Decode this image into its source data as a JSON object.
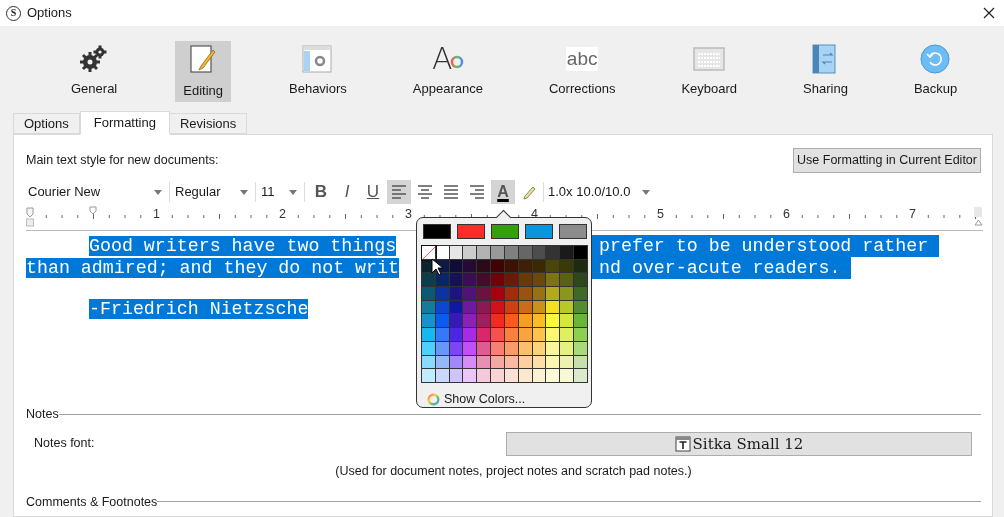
{
  "window": {
    "logo": "S",
    "title": "Options"
  },
  "categories": [
    {
      "label": "General",
      "selected": false
    },
    {
      "label": "Editing",
      "selected": true
    },
    {
      "label": "Behaviors",
      "selected": false
    },
    {
      "label": "Appearance",
      "icon_text": "A",
      "selected": false
    },
    {
      "label": "Corrections",
      "icon_text": "abc",
      "selected": false
    },
    {
      "label": "Keyboard",
      "selected": false
    },
    {
      "label": "Sharing",
      "selected": false
    },
    {
      "label": "Backup",
      "selected": false
    }
  ],
  "tabs": [
    {
      "label": "Options",
      "selected": false
    },
    {
      "label": "Formatting",
      "selected": true
    },
    {
      "label": "Revisions",
      "selected": false
    }
  ],
  "formatting": {
    "intro": "Main text style for new documents:",
    "apply_button": "Use Formatting in Current Editor",
    "font": "Courier New",
    "style": "Regular",
    "size": "11",
    "tools": [
      {
        "kind": "bold",
        "label": "B",
        "active": false
      },
      {
        "kind": "italic",
        "label": "I",
        "active": false
      },
      {
        "kind": "underline",
        "label": "U",
        "active": false
      },
      {
        "kind": "align-left",
        "active": true
      },
      {
        "kind": "align-center",
        "active": false
      },
      {
        "kind": "justify",
        "active": false
      },
      {
        "kind": "align-right",
        "active": false
      },
      {
        "kind": "text-color",
        "label": "A",
        "active": true
      },
      {
        "kind": "highlight",
        "active": false
      }
    ],
    "spacing": "1.0x 10.0/10.0",
    "ruler": [
      "1",
      "2",
      "3",
      "4",
      "5",
      "6",
      "7"
    ],
    "lines": [
      {
        "indent": true,
        "selected": true,
        "segments": [
          "Good writers have two things",
          "prefer to be understood rather"
        ]
      },
      {
        "indent": false,
        "selected": true,
        "segments": [
          "than admired; and they do not writ",
          "nd over-acute readers."
        ]
      },
      {
        "indent": true,
        "selected": true,
        "segments": [
          "-Friedrich Nietzsche"
        ]
      }
    ]
  },
  "color_popup": {
    "presets": [
      {
        "color": "#000000"
      },
      {
        "color": "#ff2a2a"
      },
      {
        "color": "#36a00c"
      },
      {
        "color": "#0a95dc"
      },
      {
        "color": "#8c8c8c"
      }
    ],
    "grid": [
      {
        "cells": [
          {
            "kind": "none"
          },
          {
            "kind": "swatch",
            "color": "#ffffff"
          },
          {
            "kind": "swatch",
            "color": "#e6e6e6"
          },
          {
            "kind": "swatch",
            "color": "#cccccc"
          },
          {
            "kind": "swatch",
            "color": "#b3b3b3"
          },
          {
            "kind": "swatch",
            "color": "#999999"
          },
          {
            "kind": "swatch",
            "color": "#808080"
          },
          {
            "kind": "swatch",
            "color": "#666666"
          },
          {
            "kind": "swatch",
            "color": "#4d4d4d"
          },
          {
            "kind": "swatch",
            "color": "#333333"
          },
          {
            "kind": "swatch",
            "color": "#1a1a1a"
          },
          {
            "kind": "swatch",
            "color": "#000000"
          }
        ]
      },
      {
        "cells": [
          {
            "kind": "swatch",
            "color": "#0b2530"
          },
          {
            "kind": "swatch",
            "color": "#0c1a45"
          },
          {
            "kind": "swatch",
            "color": "#100c35"
          },
          {
            "kind": "swatch",
            "color": "#250b33"
          },
          {
            "kind": "swatch",
            "color": "#2b0a1a"
          },
          {
            "kind": "swatch",
            "color": "#3f0306"
          },
          {
            "kind": "swatch",
            "color": "#3e1105"
          },
          {
            "kind": "swatch",
            "color": "#3d2006"
          },
          {
            "kind": "swatch",
            "color": "#3a2a04"
          },
          {
            "kind": "swatch",
            "color": "#4a4508"
          },
          {
            "kind": "swatch",
            "color": "#3a3a08"
          },
          {
            "kind": "swatch",
            "color": "#1f2b10"
          }
        ]
      },
      {
        "cells": [
          {
            "kind": "swatch",
            "color": "#0d3d4a"
          },
          {
            "kind": "swatch",
            "color": "#0a2568"
          },
          {
            "kind": "swatch",
            "color": "#14105a"
          },
          {
            "kind": "swatch",
            "color": "#380f52"
          },
          {
            "kind": "swatch",
            "color": "#450c2a"
          },
          {
            "kind": "swatch",
            "color": "#710209"
          },
          {
            "kind": "swatch",
            "color": "#6a1a0a"
          },
          {
            "kind": "swatch",
            "color": "#683a0a"
          },
          {
            "kind": "swatch",
            "color": "#684a0a"
          },
          {
            "kind": "swatch",
            "color": "#7a7413"
          },
          {
            "kind": "swatch",
            "color": "#5a6212"
          },
          {
            "kind": "swatch",
            "color": "#2f4719"
          }
        ]
      },
      {
        "cells": [
          {
            "kind": "swatch",
            "color": "#0b5a73"
          },
          {
            "kind": "swatch",
            "color": "#0a35a0"
          },
          {
            "kind": "swatch",
            "color": "#1d1480"
          },
          {
            "kind": "swatch",
            "color": "#511377"
          },
          {
            "kind": "swatch",
            "color": "#6a1341"
          },
          {
            "kind": "swatch",
            "color": "#a9000f"
          },
          {
            "kind": "swatch",
            "color": "#a02c0c"
          },
          {
            "kind": "swatch",
            "color": "#995212"
          },
          {
            "kind": "swatch",
            "color": "#987114"
          },
          {
            "kind": "swatch",
            "color": "#b3a91d"
          },
          {
            "kind": "swatch",
            "color": "#8b961d"
          },
          {
            "kind": "swatch",
            "color": "#3f6a26"
          }
        ]
      },
      {
        "cells": [
          {
            "kind": "swatch",
            "color": "#147b9d"
          },
          {
            "kind": "swatch",
            "color": "#0c47d4"
          },
          {
            "kind": "swatch",
            "color": "#0f17a3"
          },
          {
            "kind": "swatch",
            "color": "#6e1a9e"
          },
          {
            "kind": "swatch",
            "color": "#8b1a53"
          },
          {
            "kind": "swatch",
            "color": "#d3111c"
          },
          {
            "kind": "swatch",
            "color": "#d03e14"
          },
          {
            "kind": "swatch",
            "color": "#ca6c1a"
          },
          {
            "kind": "swatch",
            "color": "#c99319"
          },
          {
            "kind": "swatch",
            "color": "#f4e023"
          },
          {
            "kind": "swatch",
            "color": "#b6c924"
          },
          {
            "kind": "swatch",
            "color": "#548c33"
          }
        ]
      },
      {
        "cells": [
          {
            "kind": "swatch",
            "color": "#1393cf"
          },
          {
            "kind": "swatch",
            "color": "#0c5af4"
          },
          {
            "kind": "swatch",
            "color": "#3718b9"
          },
          {
            "kind": "swatch",
            "color": "#8a21b8"
          },
          {
            "kind": "swatch",
            "color": "#a01d5e"
          },
          {
            "kind": "swatch",
            "color": "#f22a22"
          },
          {
            "kind": "swatch",
            "color": "#fb5a1b"
          },
          {
            "kind": "swatch",
            "color": "#f79f1a"
          },
          {
            "kind": "swatch",
            "color": "#fdbc20"
          },
          {
            "kind": "swatch",
            "color": "#fef83a"
          },
          {
            "kind": "swatch",
            "color": "#d4e83a"
          },
          {
            "kind": "swatch",
            "color": "#67b53a"
          }
        ]
      },
      {
        "cells": [
          {
            "kind": "swatch",
            "color": "#15b9ee"
          },
          {
            "kind": "swatch",
            "color": "#3578f9"
          },
          {
            "kind": "swatch",
            "color": "#4d25e5"
          },
          {
            "kind": "swatch",
            "color": "#a72be5"
          },
          {
            "kind": "swatch",
            "color": "#d8286b"
          },
          {
            "kind": "swatch",
            "color": "#f84f4f"
          },
          {
            "kind": "swatch",
            "color": "#fb7f3f"
          },
          {
            "kind": "swatch",
            "color": "#f9a43d"
          },
          {
            "kind": "swatch",
            "color": "#fdc44a"
          },
          {
            "kind": "swatch",
            "color": "#fdf772"
          },
          {
            "kind": "swatch",
            "color": "#e0ee62"
          },
          {
            "kind": "swatch",
            "color": "#8ccf52"
          }
        ]
      },
      {
        "cells": [
          {
            "kind": "swatch",
            "color": "#4fd0fc"
          },
          {
            "kind": "swatch",
            "color": "#6897fb"
          },
          {
            "kind": "swatch",
            "color": "#7d45f5"
          },
          {
            "kind": "swatch",
            "color": "#c050f8"
          },
          {
            "kind": "swatch",
            "color": "#e05b8f"
          },
          {
            "kind": "swatch",
            "color": "#f97e73"
          },
          {
            "kind": "swatch",
            "color": "#fc9a69"
          },
          {
            "kind": "swatch",
            "color": "#fbbf6e"
          },
          {
            "kind": "swatch",
            "color": "#fdd27a"
          },
          {
            "kind": "swatch",
            "color": "#fcf49a"
          },
          {
            "kind": "swatch",
            "color": "#e5f182"
          },
          {
            "kind": "swatch",
            "color": "#a8d97a"
          }
        ]
      },
      {
        "cells": [
          {
            "kind": "swatch",
            "color": "#89dafc"
          },
          {
            "kind": "swatch",
            "color": "#95b8f8"
          },
          {
            "kind": "swatch",
            "color": "#a286fa"
          },
          {
            "kind": "swatch",
            "color": "#d58cf8"
          },
          {
            "kind": "swatch",
            "color": "#ea8fb4"
          },
          {
            "kind": "swatch",
            "color": "#f7a7a1"
          },
          {
            "kind": "swatch",
            "color": "#fcb9a1"
          },
          {
            "kind": "swatch",
            "color": "#fcd0a1"
          },
          {
            "kind": "swatch",
            "color": "#fde0a5"
          },
          {
            "kind": "swatch",
            "color": "#fcf6b4"
          },
          {
            "kind": "swatch",
            "color": "#eef2b0"
          },
          {
            "kind": "swatch",
            "color": "#c5e0ad"
          }
        ]
      },
      {
        "cells": [
          {
            "kind": "swatch",
            "color": "#c0edfd"
          },
          {
            "kind": "swatch",
            "color": "#cad8fc"
          },
          {
            "kind": "swatch",
            "color": "#d0c2fb"
          },
          {
            "kind": "swatch",
            "color": "#ecc5fb"
          },
          {
            "kind": "swatch",
            "color": "#f6c8db"
          },
          {
            "kind": "swatch",
            "color": "#fbd4d2"
          },
          {
            "kind": "swatch",
            "color": "#fde0d5"
          },
          {
            "kind": "swatch",
            "color": "#fde8cd"
          },
          {
            "kind": "swatch",
            "color": "#fef0d3"
          },
          {
            "kind": "swatch",
            "color": "#fdfad5"
          },
          {
            "kind": "swatch",
            "color": "#f7f9d6"
          },
          {
            "kind": "swatch",
            "color": "#dbeacd"
          }
        ]
      }
    ],
    "show_colors": "Show Colors..."
  },
  "notes": {
    "heading": "Notes",
    "font_label": "Notes font:",
    "font_button": "Sitka Small 12",
    "caption": "(Used for document notes, project notes and scratch pad notes.)"
  },
  "comments": {
    "heading": "Comments & Footnotes"
  }
}
